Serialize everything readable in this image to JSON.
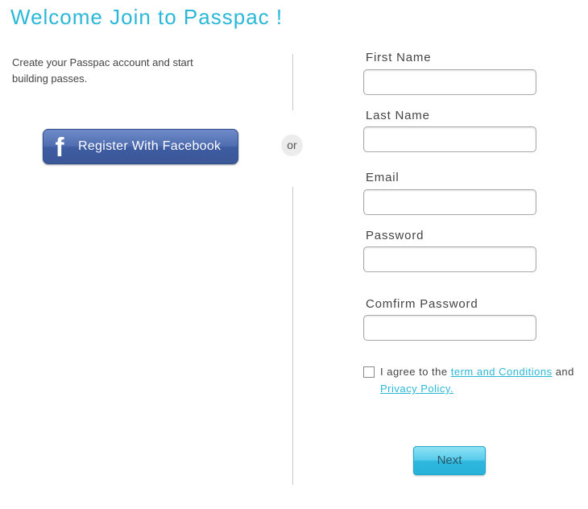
{
  "header": {
    "title": "Welcome Join to Passpac !"
  },
  "left": {
    "intro": "Create your Passpac account and start building passes.",
    "facebook_button_label": "Register With Facebook",
    "facebook_icon_glyph": "f"
  },
  "separator": {
    "or_label": "or"
  },
  "form": {
    "first_name": {
      "label": "First Name",
      "value": ""
    },
    "last_name": {
      "label": "Last Name",
      "value": ""
    },
    "email": {
      "label": "Email",
      "value": ""
    },
    "password": {
      "label": "Password",
      "value": ""
    },
    "confirm_password": {
      "label": "Comfirm Password",
      "value": ""
    },
    "agree": {
      "checked": false,
      "prefix": "I agree to the ",
      "terms_link": "term and Conditions",
      "middle": " and ",
      "privacy_link": "Privacy Policy."
    },
    "next_label": "Next"
  },
  "colors": {
    "accent": "#2bb8d8",
    "facebook": "#3b5798",
    "next_button": "#55cbea",
    "divider": "#c9c9c9"
  }
}
